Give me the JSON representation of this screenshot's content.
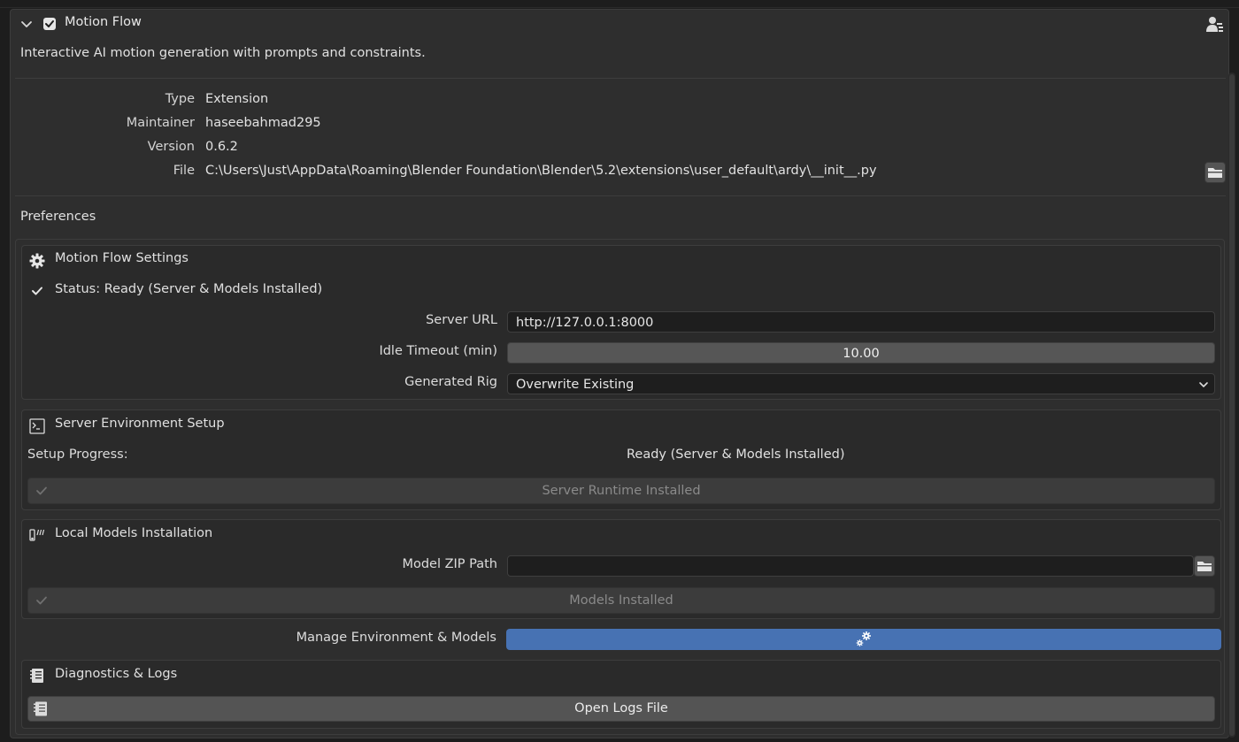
{
  "addon": {
    "title": "Motion Flow",
    "enabled": true,
    "description": "Interactive AI motion generation with prompts and constraints.",
    "meta": {
      "type_label": "Type",
      "type_value": "Extension",
      "maintainer_label": "Maintainer",
      "maintainer_value": "haseebahmad295",
      "version_label": "Version",
      "version_value": "0.6.2",
      "file_label": "File",
      "file_value": "C:\\Users\\Just\\AppData\\Roaming\\Blender Foundation\\Blender\\5.2\\extensions\\user_default\\ardy\\__init__.py"
    }
  },
  "preferences": {
    "title": "Preferences",
    "settings": {
      "title": "Motion Flow Settings",
      "status": "Status: Ready (Server & Models Installed)",
      "server_url_label": "Server URL",
      "server_url_value": "http://127.0.0.1:8000",
      "idle_timeout_label": "Idle Timeout (min)",
      "idle_timeout_value": "10.00",
      "generated_rig_label": "Generated Rig",
      "generated_rig_value": "Overwrite Existing"
    },
    "server_env": {
      "title": "Server Environment Setup",
      "progress_label": "Setup Progress:",
      "progress_value": "Ready (Server & Models Installed)",
      "button_label": "Server Runtime Installed"
    },
    "local_models": {
      "title": "Local Models Installation",
      "zip_label": "Model ZIP Path",
      "zip_value": "",
      "button_label": "Models Installed"
    },
    "manage_label": "Manage Environment & Models",
    "diagnostics": {
      "title": "Diagnostics & Logs",
      "button_label": "Open Logs File"
    }
  },
  "colors": {
    "accent_blue": "#4772b3",
    "panel_bg": "#2e2e2e",
    "window_bg": "#1d1d1d"
  },
  "icons": [
    "chevron-down-icon",
    "checkbox-icon",
    "user-icon",
    "folder-icon",
    "gear-icon",
    "check-icon",
    "console-icon",
    "models-icon",
    "gears-icon",
    "logs-icon"
  ]
}
